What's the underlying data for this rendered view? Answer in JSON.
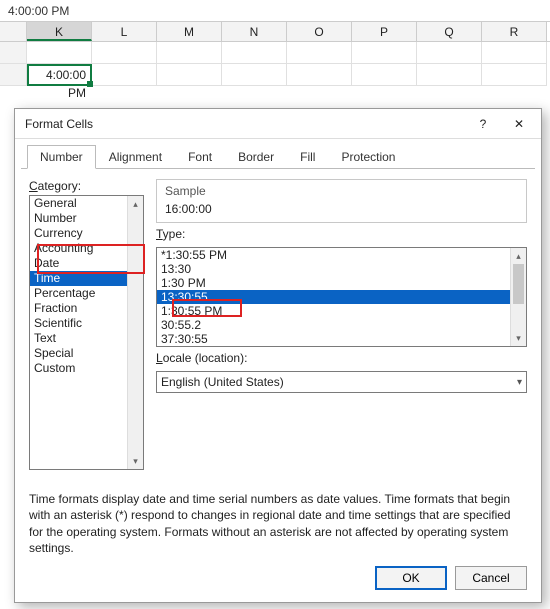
{
  "formula_bar": "4:00:00 PM",
  "columns": [
    "K",
    "L",
    "M",
    "N",
    "O",
    "P",
    "Q",
    "R"
  ],
  "cell_value": "4:00:00 PM",
  "dialog": {
    "title": "Format Cells",
    "help_glyph": "?",
    "close_glyph": "✕",
    "tabs": [
      "Number",
      "Alignment",
      "Font",
      "Border",
      "Fill",
      "Protection"
    ],
    "active_tab": "Number",
    "category_label": "Category:",
    "categories": [
      "General",
      "Number",
      "Currency",
      "Accounting",
      "Date",
      "Time",
      "Percentage",
      "Fraction",
      "Scientific",
      "Text",
      "Special",
      "Custom"
    ],
    "category_selected": "Time",
    "sample_label": "Sample",
    "sample_value": "16:00:00",
    "type_label": "Type:",
    "types": [
      "*1:30:55 PM",
      "13:30",
      "1:30 PM",
      "13:30:55",
      "1:30:55 PM",
      "30:55.2",
      "37:30:55"
    ],
    "type_selected": "13:30:55",
    "locale_label": "Locale (location):",
    "locale_value": "English (United States)",
    "description": "Time formats display date and time serial numbers as date values.  Time formats that begin with an asterisk (*) respond to changes in regional date and time settings that are specified for the operating system. Formats without an asterisk are not affected by operating system settings.",
    "ok": "OK",
    "cancel": "Cancel"
  }
}
